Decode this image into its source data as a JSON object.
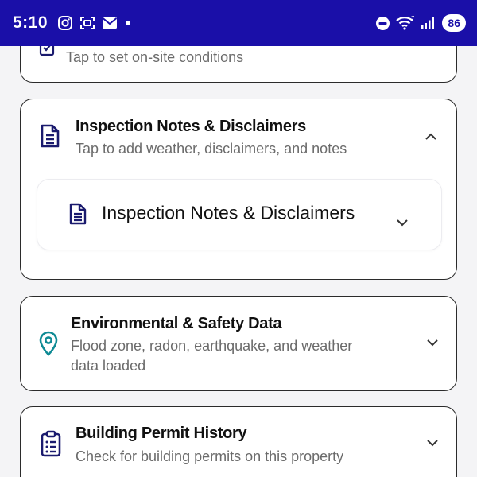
{
  "status_bar": {
    "time": "5:10",
    "battery": "86",
    "left_icons": [
      "instagram-icon",
      "screenshot-icon",
      "mail-icon",
      "notification-dot-icon"
    ],
    "right_icons": [
      "do-not-disturb-icon",
      "wifi-icon",
      "signal-icon",
      "battery-icon"
    ]
  },
  "cards": {
    "on_site": {
      "subtitle": "Tap to set on-site conditions",
      "icon": "checkbox-icon"
    },
    "inspection_notes": {
      "title": "Inspection Notes & Disclaimers",
      "subtitle": "Tap to add weather, disclaimers, and notes",
      "icon": "document-icon",
      "expanded": true,
      "inner": {
        "title": "Inspection Notes & Disclaimers",
        "icon": "document-icon"
      }
    },
    "environmental": {
      "title": "Environmental & Safety Data",
      "subtitle_line1": "Flood zone, radon, earthquake, and weather",
      "subtitle_line2": "data loaded",
      "icon": "location-pin-icon"
    },
    "permit_history": {
      "title": "Building Permit History",
      "subtitle": "Check for building permits on this property",
      "icon": "clipboard-icon"
    }
  },
  "colors": {
    "status_bar": "#1a0fa8",
    "card_border": "#2b2b2b",
    "icon_dark": "#1a1a6e",
    "icon_teal": "#0e8a94",
    "subtitle": "#6b6b6b"
  }
}
